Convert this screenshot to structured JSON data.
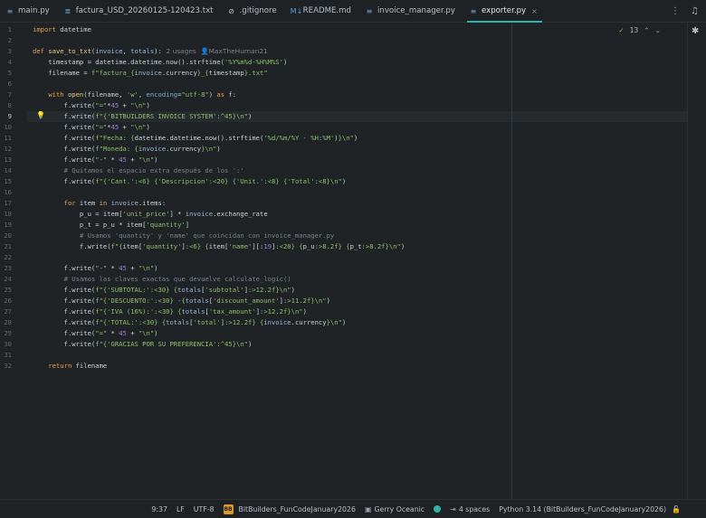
{
  "tabs": [
    {
      "icon": "python-file-icon",
      "glyph": "≡",
      "label": "main.py",
      "active": false
    },
    {
      "icon": "text-file-icon",
      "glyph": "≣",
      "label": "factura_USD_20260125-120423.txt",
      "active": false
    },
    {
      "icon": "gitignore-icon",
      "glyph": "⊘",
      "label": ".gitignore",
      "active": false
    },
    {
      "icon": "markdown-icon",
      "glyph": "M↓",
      "label": "README.md",
      "active": false
    },
    {
      "icon": "python-file-icon",
      "glyph": "≡",
      "label": "invoice_manager.py",
      "active": false
    },
    {
      "icon": "python-file-icon",
      "glyph": "≡",
      "label": "exporter.py",
      "active": true
    }
  ],
  "inspection": {
    "count": "13"
  },
  "hint": {
    "usages": "2 usages",
    "author": "MaxTheHuman21"
  },
  "lines": [
    {
      "n": "1",
      "html": "<span class='kw'>import</span> datetime"
    },
    {
      "n": "2",
      "html": ""
    },
    {
      "n": "3",
      "html": "<span class='kw'>def</span> <span class='fn'>save_to_txt</span>(<span class='pm'>invoice</span>, <span class='pm'>totals</span>):"
    },
    {
      "n": "4",
      "html": "    timestamp = datetime.datetime.now().strftime(<span class='st'>'%Y%m%d-%H%M%S'</span>)"
    },
    {
      "n": "5",
      "html": "    filename = <span class='st'>f\"factura_{</span><span class='pm'>invoice</span>.currency<span class='st'>}_{</span>timestamp<span class='st'>}.txt\"</span>"
    },
    {
      "n": "6",
      "html": ""
    },
    {
      "n": "7",
      "html": "    <span class='kw'>with</span> <span class='fn'>open</span>(filename, <span class='st'>'w'</span>, <span class='at'>encoding</span>=<span class='st'>\"utf-8\"</span>) <span class='kw'>as</span> f:"
    },
    {
      "n": "8",
      "html": "        f.write(<span class='st'>\"=\"</span>*<span class='ck'>45</span> + <span class='st'>\"\\n\"</span>)"
    },
    {
      "n": "9",
      "html": "        f.write(<span class='st'>f\"{'BITBUILDERS INVOICE SYSTEM':^45}\\n\"</span>)"
    },
    {
      "n": "10",
      "html": "        f.write(<span class='st'>\"=\"</span>*<span class='ck'>45</span> + <span class='st'>\"\\n\"</span>)"
    },
    {
      "n": "11",
      "html": "        f.write(<span class='st'>f\"Fecha: {</span>datetime.datetime.now().strftime(<span class='st'>'%d/%m/%Y - %H:%M'</span>)<span class='st'>}\\n\"</span>)"
    },
    {
      "n": "12",
      "html": "        f.write(<span class='st'>f\"Moneda: {</span><span class='pm'>invoice</span>.currency<span class='st'>}\\n\"</span>)"
    },
    {
      "n": "13",
      "html": "        f.write(<span class='st'>\"-\"</span> * <span class='ck'>45</span> + <span class='st'>\"\\n\"</span>)"
    },
    {
      "n": "14",
      "html": "        <span class='cm'># Quitamos el espacio extra después de los ':'</span>"
    },
    {
      "n": "15",
      "html": "        f.write(<span class='st'>f\"{'Cant.':&lt;6} {'Descripcion':&lt;20} {'Unit.':&lt;8} {'Total':&lt;8}\\n\"</span>)"
    },
    {
      "n": "16",
      "html": ""
    },
    {
      "n": "17",
      "html": "        <span class='kw'>for</span> item <span class='kw'>in</span> <span class='pm'>invoice</span>.items:"
    },
    {
      "n": "18",
      "html": "            p_u = item[<span class='st'>'unit_price'</span>] * <span class='pm'>invoice</span>.exchange_rate"
    },
    {
      "n": "19",
      "html": "            p_t = p_u * item[<span class='st'>'quantity'</span>]"
    },
    {
      "n": "20",
      "html": "            <span class='cm'># Usamos 'quantity' y 'name' que coincidan con invoice_manager.py</span>"
    },
    {
      "n": "21",
      "html": "            f.write(<span class='st'>f\"{</span>item[<span class='st'>'quantity'</span>]<span class='st'>:&lt;6} {</span>item[<span class='st'>'name'</span>][:<span class='ck'>19</span>]<span class='st'>:&lt;20} {</span>p_u<span class='st'>:&gt;8.2f} {</span>p_t<span class='st'>:&gt;8.2f}\\n\"</span>)"
    },
    {
      "n": "22",
      "html": ""
    },
    {
      "n": "23",
      "html": "        f.write(<span class='st'>\"-\"</span> * <span class='ck'>45</span> + <span class='st'>\"\\n\"</span>)"
    },
    {
      "n": "24",
      "html": "        <span class='cm'># Usamos las claves exactas que devuelve calculate_logic()</span>"
    },
    {
      "n": "25",
      "html": "        f.write(<span class='st'>f\"{'SUBTOTAL:':&lt;30} {</span><span class='pm'>totals</span>[<span class='st'>'subtotal'</span>]<span class='st'>:&gt;12.2f}\\n\"</span>)"
    },
    {
      "n": "26",
      "html": "        f.write(<span class='st'>f\"{'DESCUENTO:':&lt;30} -{</span><span class='pm'>totals</span>[<span class='st'>'discount_amount'</span>]<span class='st'>:&gt;11.2f}\\n\"</span>)"
    },
    {
      "n": "27",
      "html": "        f.write(<span class='st'>f\"{'IVA (16%):':&lt;30} {</span><span class='pm'>totals</span>[<span class='st'>'tax_amount'</span>]<span class='st'>:&gt;12.2f}\\n\"</span>)"
    },
    {
      "n": "28",
      "html": "        f.write(<span class='st'>f\"{'TOTAL:':&lt;30} {</span><span class='pm'>totals</span>[<span class='st'>'total'</span>]<span class='st'>:&gt;12.2f} {</span><span class='pm'>invoice</span>.currency<span class='st'>}\\n\"</span>)"
    },
    {
      "n": "29",
      "html": "        f.write(<span class='st'>\"=\"</span> * <span class='ck'>45</span> + <span class='st'>\"\\n\"</span>)"
    },
    {
      "n": "30",
      "html": "        f.write(<span class='st'>f\"{'GRACIAS POR SU PREFERENCIA':^45}\\n\"</span>)"
    },
    {
      "n": "31",
      "html": ""
    },
    {
      "n": "32",
      "html": "    <span class='kw'>return</span> filename"
    }
  ],
  "current_line": "9",
  "status": {
    "position": "9:37",
    "line_sep": "LF",
    "encoding": "UTF-8",
    "project_badge": "BB",
    "project": "BitBuilders_FunCodeJanuary2026",
    "theme": "Gerry Oceanic",
    "indent": "4 spaces",
    "interpreter": "Python 3.14 (BitBuilders_FunCodeJanuary2026)"
  },
  "colors": {
    "accent": "#2bb3a8",
    "keyword": "#e8a04e",
    "string": "#8fbf69",
    "comment": "#7a8289"
  }
}
